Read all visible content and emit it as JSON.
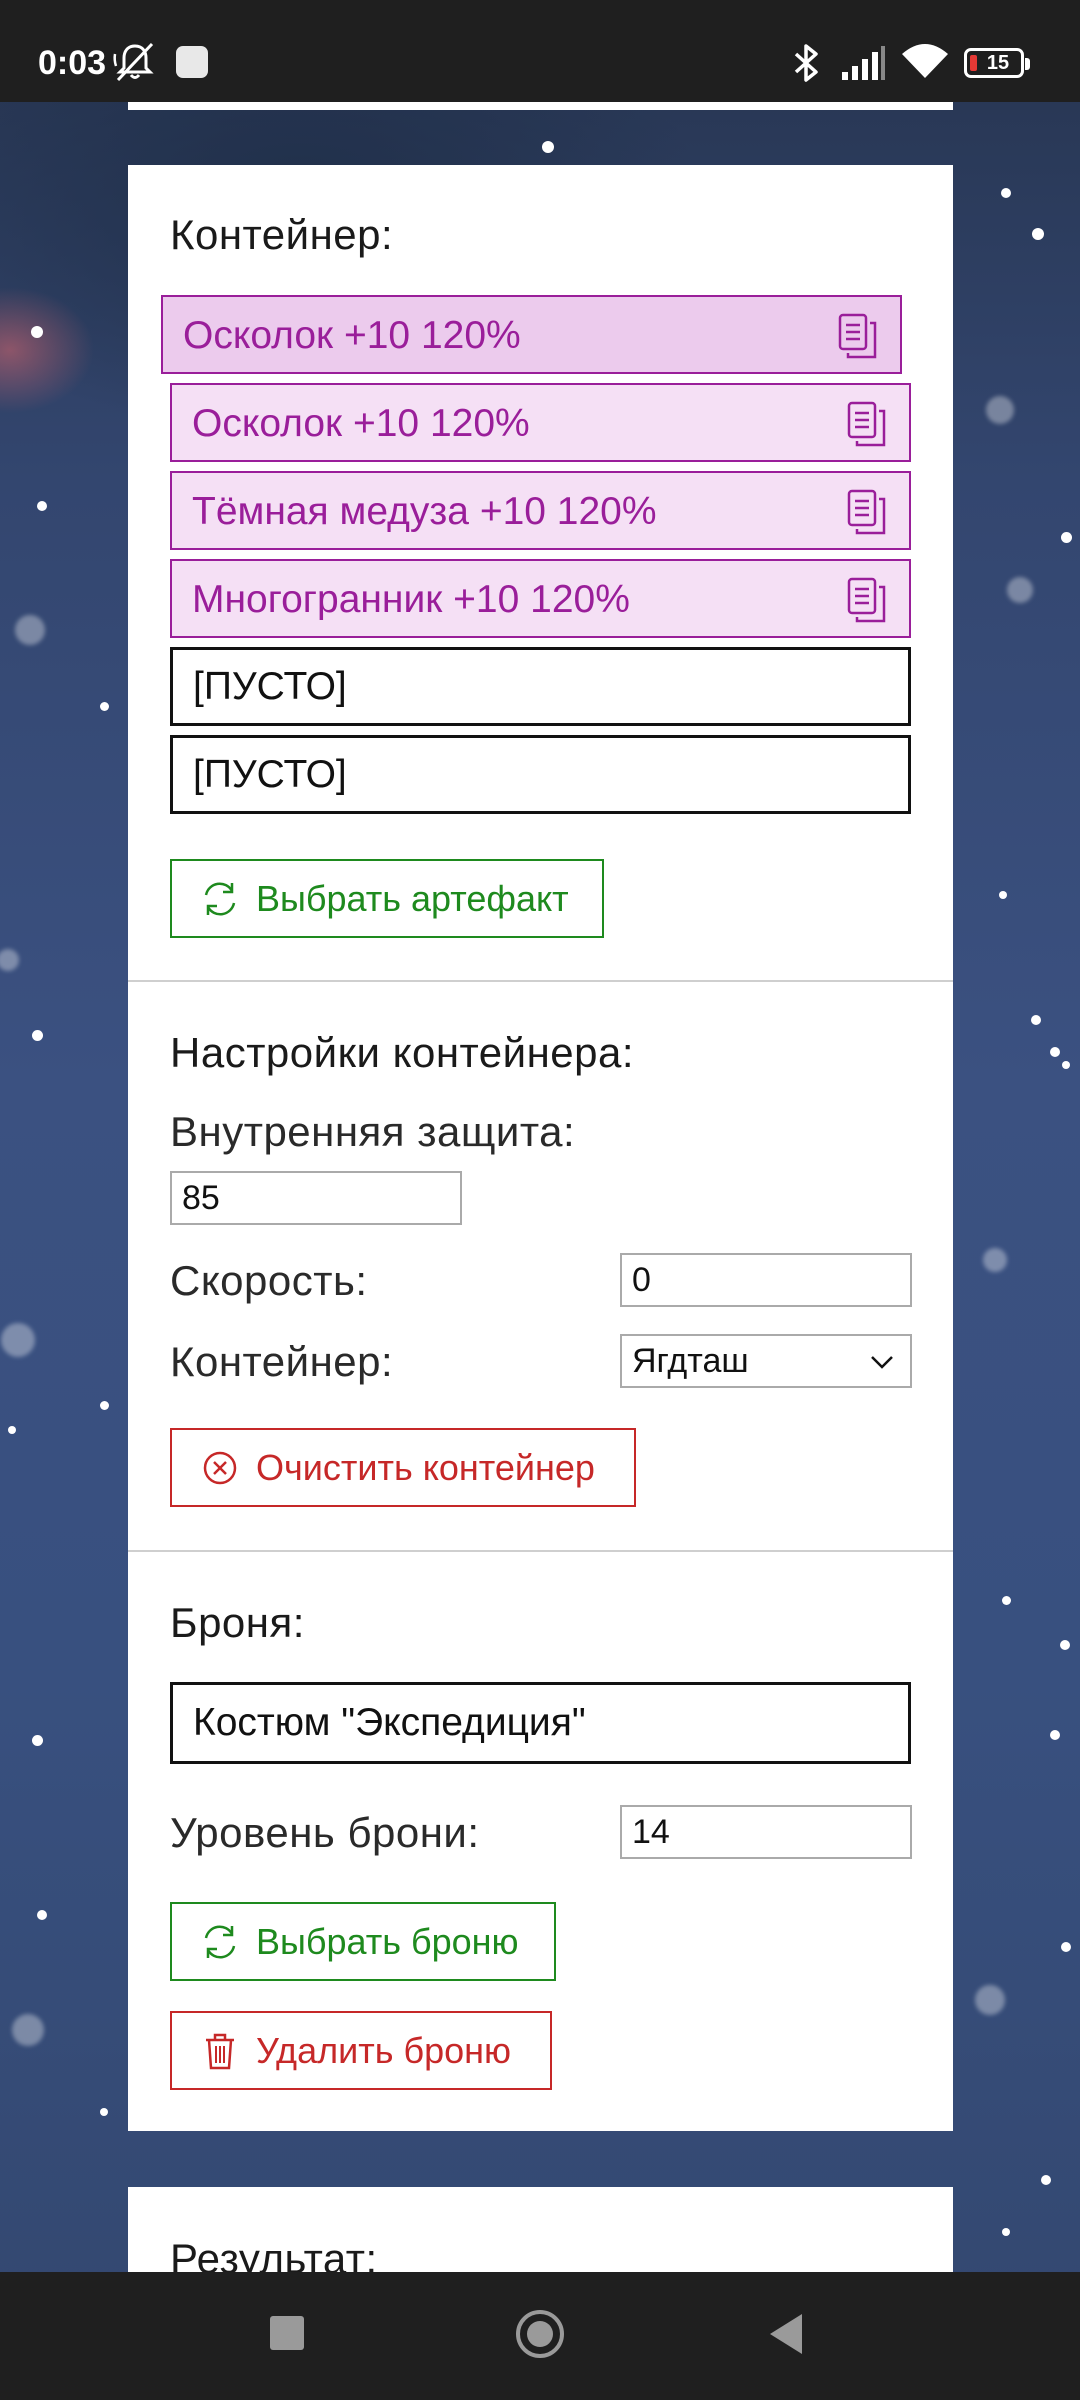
{
  "status_bar": {
    "time": "0:03",
    "battery": "15",
    "icons": [
      "mute-icon",
      "app-notification-icon",
      "bluetooth-icon",
      "signal-icon",
      "wifi-icon",
      "battery-icon"
    ]
  },
  "container_section": {
    "title": "Контейнер:",
    "slots": [
      {
        "label": "Осколок +10 120%",
        "state": "selected"
      },
      {
        "label": "Осколок +10 120%",
        "state": "filled"
      },
      {
        "label": "Тёмная медуза +10 120%",
        "state": "filled"
      },
      {
        "label": "Многогранник +10 120%",
        "state": "filled"
      },
      {
        "label": "[ПУСТО]",
        "state": "empty"
      },
      {
        "label": "[ПУСТО]",
        "state": "empty"
      }
    ],
    "choose_artifact_label": "Выбрать артефакт"
  },
  "container_settings": {
    "title": "Настройки контейнера:",
    "inner_protection_label": "Внутренняя защита:",
    "inner_protection_value": "85",
    "speed_label": "Скорость:",
    "speed_value": "0",
    "container_label": "Контейнер:",
    "container_selected": "Ягдташ",
    "clear_label": "Очистить контейнер"
  },
  "armor_section": {
    "title": "Броня:",
    "armor_name": "Костюм \"Экспедиция\"",
    "armor_level_label": "Уровень брони:",
    "armor_level_value": "14",
    "choose_armor_label": "Выбрать броню",
    "delete_armor_label": "Удалить броню"
  },
  "result_section": {
    "title": "Результат:"
  },
  "colors": {
    "accent_purple": "#9a1e9a",
    "green": "#1e8a1e",
    "red": "#c62828"
  }
}
